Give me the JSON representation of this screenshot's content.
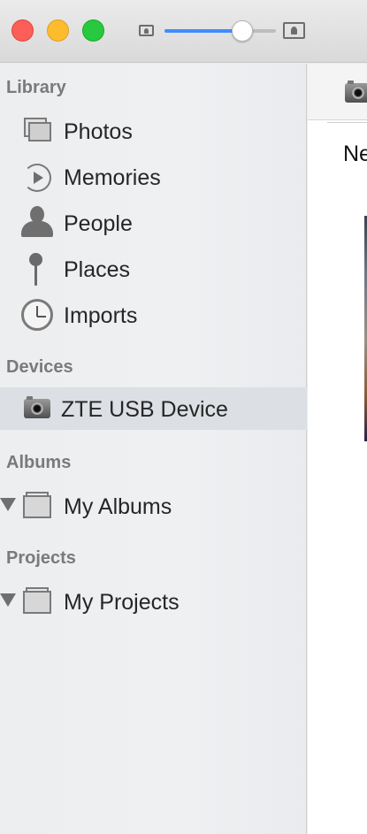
{
  "window": {
    "controls": [
      "close",
      "minimize",
      "maximize"
    ],
    "zoom": {
      "value": 0.7,
      "small_icon": "photo-small-icon",
      "large_icon": "photo-large-icon"
    }
  },
  "sidebar": {
    "library": {
      "header": "Library",
      "items": [
        {
          "label": "Photos",
          "icon": "photos-icon"
        },
        {
          "label": "Memories",
          "icon": "memories-icon"
        },
        {
          "label": "People",
          "icon": "people-icon"
        },
        {
          "label": "Places",
          "icon": "pin-icon"
        },
        {
          "label": "Imports",
          "icon": "clock-icon"
        }
      ]
    },
    "devices": {
      "header": "Devices",
      "items": [
        {
          "label": "ZTE USB Device",
          "icon": "camera-icon",
          "selected": true
        }
      ]
    },
    "albums": {
      "header": "Albums",
      "items": [
        {
          "label": "My Albums",
          "icon": "album-stack-icon",
          "collapsed": false
        }
      ]
    },
    "projects": {
      "header": "Projects",
      "items": [
        {
          "label": "My Projects",
          "icon": "album-stack-icon",
          "collapsed": false
        }
      ]
    }
  },
  "main": {
    "heading": "Ne",
    "toolbar_icon": "camera-icon"
  },
  "colors": {
    "accent": "#3f8cff",
    "close": "#fc5f57",
    "minimize": "#fdbc2e",
    "maximize": "#28c840",
    "selection": "#dcdfe3"
  }
}
